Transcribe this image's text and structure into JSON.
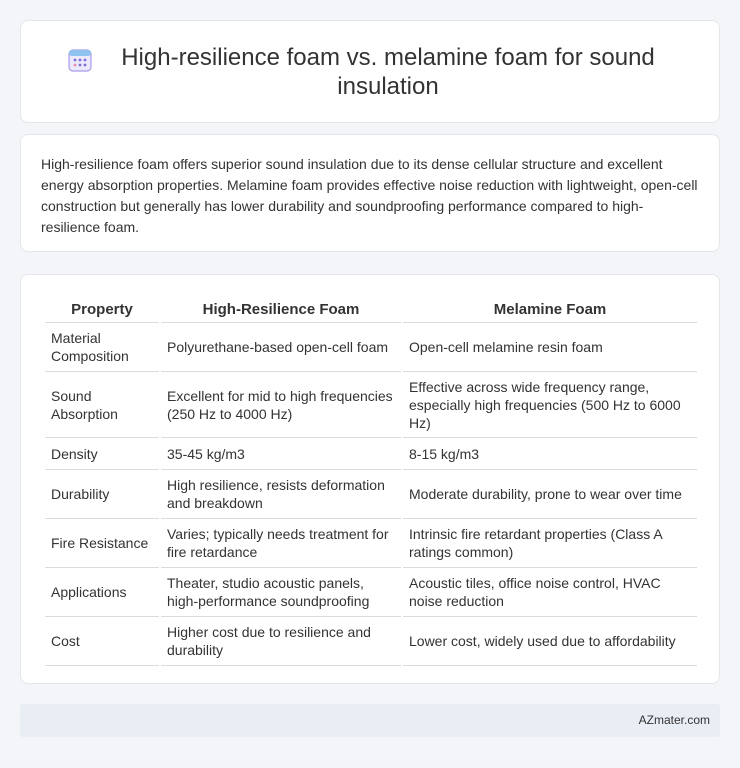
{
  "header": {
    "title": "High-resilience foam vs. melamine foam for sound insulation",
    "icon": "calendar-grid-icon"
  },
  "summary": {
    "text": "High-resilience foam offers superior sound insulation due to its dense cellular structure and excellent energy absorption properties. Melamine foam provides effective noise reduction with lightweight, open-cell construction but generally has lower durability and soundproofing performance compared to high-resilience foam."
  },
  "table": {
    "headers": [
      "Property",
      "High-Resilience Foam",
      "Melamine Foam"
    ],
    "rows": [
      [
        "Material Composition",
        "Polyurethane-based open-cell foam",
        "Open-cell melamine resin foam"
      ],
      [
        "Sound Absorption",
        "Excellent for mid to high frequencies (250 Hz to 4000 Hz)",
        "Effective across wide frequency range, especially high frequencies (500 Hz to 6000 Hz)"
      ],
      [
        "Density",
        "35-45 kg/m3",
        "8-15 kg/m3"
      ],
      [
        "Durability",
        "High resilience, resists deformation and breakdown",
        "Moderate durability, prone to wear over time"
      ],
      [
        "Fire Resistance",
        "Varies; typically needs treatment for fire retardance",
        "Intrinsic fire retardant properties (Class A ratings common)"
      ],
      [
        "Applications",
        "Theater, studio acoustic panels, high-performance soundproofing",
        "Acoustic tiles, office noise control, HVAC noise reduction"
      ],
      [
        "Cost",
        "Higher cost due to resilience and durability",
        "Lower cost, widely used due to affordability"
      ]
    ]
  },
  "footer": {
    "brand": "AZmater.com"
  },
  "colors": {
    "background": "#f3f5f8",
    "card": "#ffffff",
    "footer": "#e9edf4",
    "icon_accent": "#7c6fd6"
  }
}
